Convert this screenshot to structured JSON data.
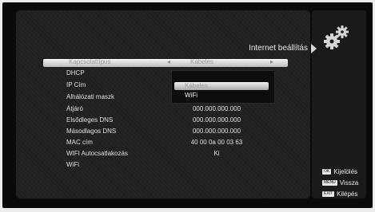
{
  "header": {
    "title": "Internet beállítás"
  },
  "settings": {
    "highlighted": {
      "label": "Kapcsolattípus",
      "value": "Kábeles"
    },
    "rows": [
      {
        "label": "DHCP",
        "value": ""
      },
      {
        "label": "IP Cím",
        "value": ""
      },
      {
        "label": "Alhálózati maszk",
        "value": ""
      },
      {
        "label": "Átjáró",
        "value": "000.000.000.000"
      },
      {
        "label": "Elsődleges DNS",
        "value": "000.000.000.000"
      },
      {
        "label": "Másodlagos DNS",
        "value": "000.000.000.000"
      },
      {
        "label": "MAC cím",
        "value": "40 00 0a 00 03 63"
      },
      {
        "label": "WIFI Autocsatlakozás",
        "value": "Ki"
      },
      {
        "label": "WiFi",
        "value": ""
      }
    ]
  },
  "dropdown": {
    "options": [
      "Kábeles",
      "WiFi"
    ],
    "selected": "Kábeles"
  },
  "legend": [
    {
      "key": "OK",
      "label": "Kijelölés",
      "icon": "ok-key-icon"
    },
    {
      "key": "MENU",
      "label": "Vissza",
      "icon": "menu-key-icon"
    },
    {
      "key": "EXIT",
      "label": "Kilépés",
      "icon": "exit-key-icon"
    }
  ]
}
